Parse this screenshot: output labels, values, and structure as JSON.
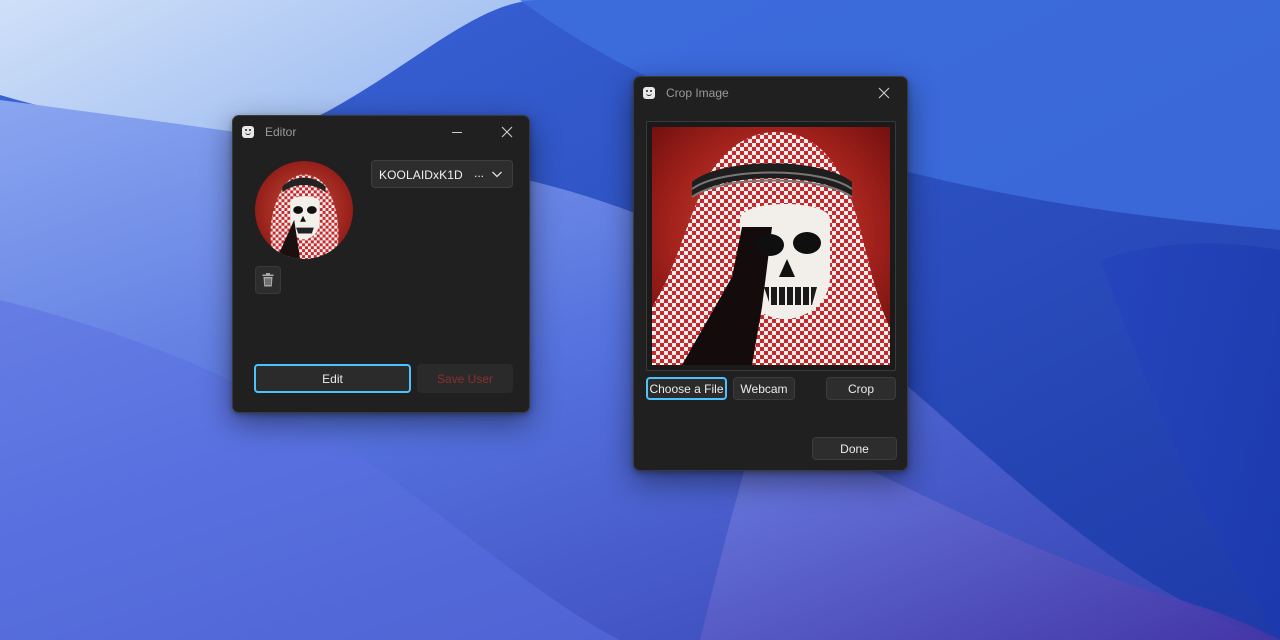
{
  "editor_window": {
    "title": "Editor",
    "selected_user": "KOOLAIDxK1D",
    "more_label": "...",
    "edit_label": "Edit",
    "save_user_label": "Save User"
  },
  "crop_window": {
    "title": "Crop Image",
    "choose_file_label": "Choose a File",
    "webcam_label": "Webcam",
    "crop_label": "Crop",
    "done_label": "Done"
  },
  "colors": {
    "window_bg": "#202020",
    "accent_focus": "#4cc2ff",
    "save_text": "#8a2f2f"
  },
  "icons": [
    "app-icon",
    "minimize-icon",
    "close-icon",
    "chevron-down-icon",
    "trash-icon"
  ]
}
